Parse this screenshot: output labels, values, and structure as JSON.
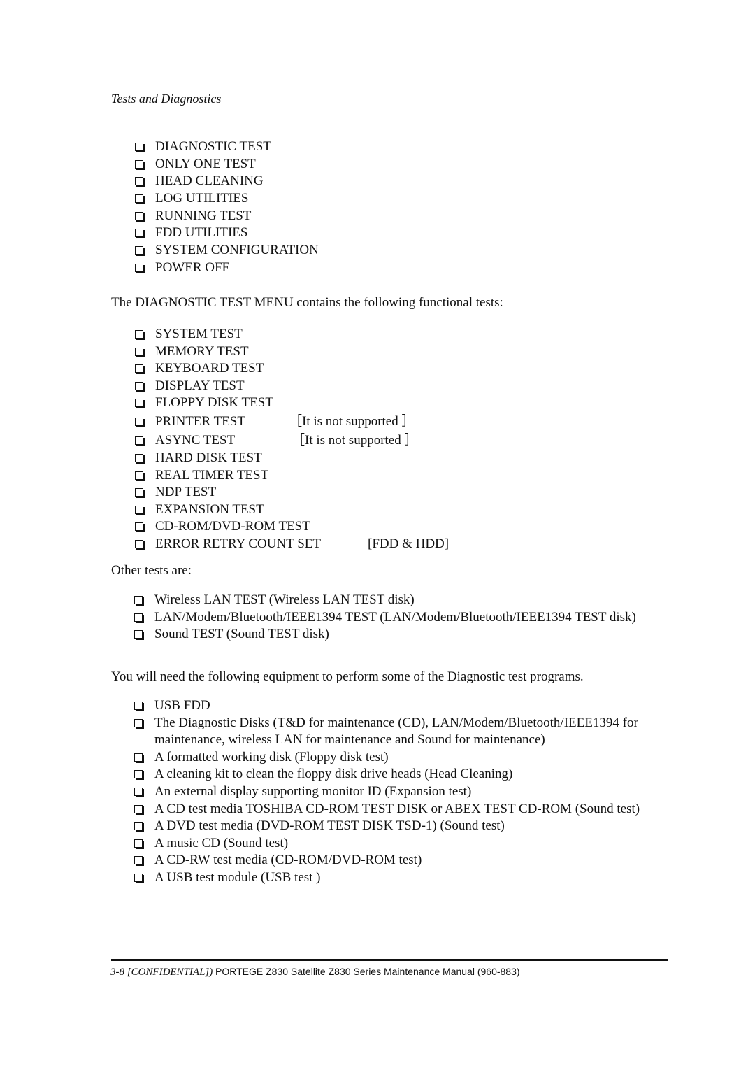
{
  "header": {
    "title": "Tests and Diagnostics"
  },
  "main_menu": {
    "items": [
      "DIAGNOSTIC TEST",
      "ONLY ONE TEST",
      "HEAD CLEANING",
      "LOG UTILITIES",
      "RUNNING TEST",
      "FDD UTILITIES",
      "SYSTEM CONFIGURATION",
      "POWER OFF"
    ]
  },
  "intro_paragraph": "The DIAGNOSTIC TEST MENU contains the following functional tests:",
  "functional_tests": {
    "items": [
      {
        "label": "SYSTEM TEST",
        "note": ""
      },
      {
        "label": "MEMORY TEST",
        "note": ""
      },
      {
        "label": "KEYBOARD TEST",
        "note": ""
      },
      {
        "label": "DISPLAY TEST",
        "note": ""
      },
      {
        "label": "FLOPPY DISK TEST",
        "note": ""
      },
      {
        "label": "PRINTER TEST",
        "note": "［It is not supported ］"
      },
      {
        "label": "ASYNC TEST",
        "note": "［It is not supported ］"
      },
      {
        "label": "HARD DISK TEST",
        "note": ""
      },
      {
        "label": "REAL TIMER TEST",
        "note": ""
      },
      {
        "label": "NDP TEST",
        "note": ""
      },
      {
        "label": "EXPANSION TEST",
        "note": ""
      },
      {
        "label": "CD-ROM/DVD-ROM TEST",
        "note": ""
      },
      {
        "label": "ERROR RETRY COUNT SET",
        "note": "[FDD & HDD]"
      }
    ]
  },
  "other_tests_heading": "Other tests are:",
  "other_tests": {
    "items": [
      "Wireless LAN TEST (Wireless LAN TEST disk)",
      "LAN/Modem/Bluetooth/IEEE1394 TEST (LAN/Modem/Bluetooth/IEEE1394 TEST disk)",
      "Sound TEST (Sound TEST disk)"
    ]
  },
  "equipment_paragraph": "You will need the following equipment to perform some of the Diagnostic test programs.",
  "equipment": {
    "items": [
      "USB FDD",
      "The Diagnostic Disks (T&D for maintenance (CD), LAN/Modem/Bluetooth/IEEE1394 for maintenance, wireless LAN for maintenance and Sound for maintenance)",
      "A formatted working disk (Floppy disk test)",
      "A cleaning kit to clean the floppy disk drive heads (Head Cleaning)",
      "An external display supporting monitor ID (Expansion test)",
      "A CD test media TOSHIBA CD-ROM TEST DISK or ABEX TEST CD-ROM (Sound test)",
      "A DVD test media (DVD-ROM TEST DISK TSD-1) (Sound test)",
      "A music CD (Sound test)",
      "A CD-RW test media (CD-ROM/DVD-ROM test)",
      "A USB test module (USB test )"
    ]
  },
  "footer": {
    "page_number": "3-8 [CONFIDENTIAL])",
    "manual_title": "PORTEGE Z830 Satellite Z830 Series Maintenance Manual (960-883)"
  },
  "icons": {
    "bullet": "checkbox-square-icon"
  }
}
